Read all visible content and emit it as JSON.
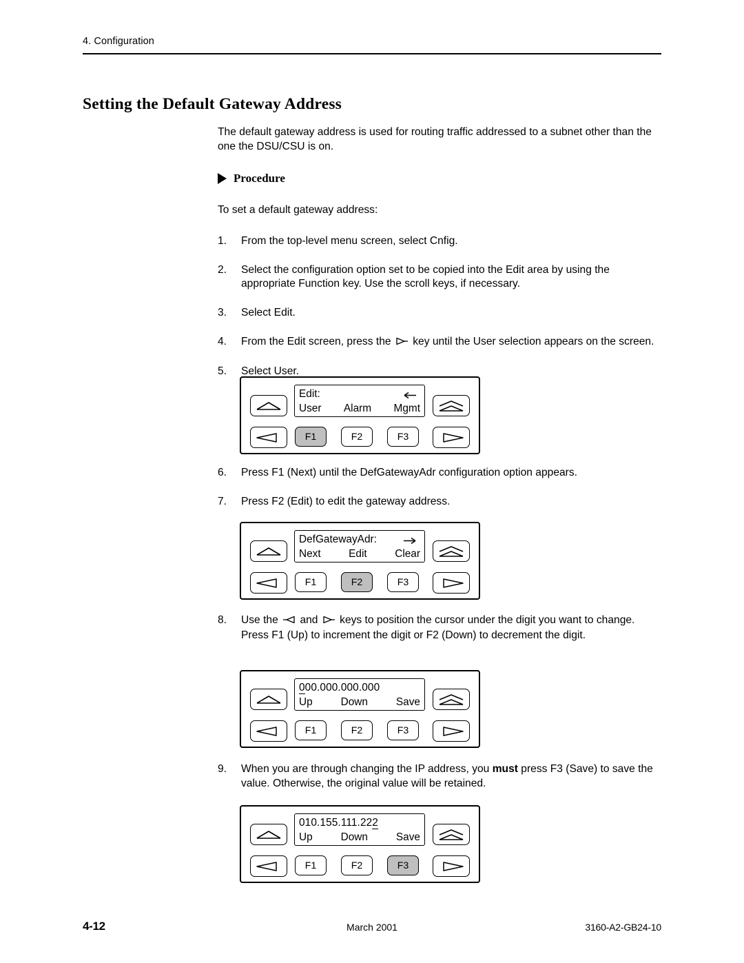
{
  "header": {
    "running_head": "4. Configuration"
  },
  "section": {
    "title": "Setting the Default Gateway Address"
  },
  "intro": {
    "paragraph": "The default gateway address is used for routing traffic addressed to a subnet other than the one the DSU/CSU is on."
  },
  "procedure": {
    "heading": "Procedure",
    "lead_in": "To set a default gateway address:",
    "steps": [
      {
        "num": "1.",
        "text": "From the top-level menu screen, select Cnfig."
      },
      {
        "num": "2.",
        "text": "Select the configuration option set to be copied into the Edit area by using the appropriate Function key. Use the scroll keys, if necessary."
      },
      {
        "num": "3.",
        "text": "Select Edit."
      },
      {
        "num": "4.",
        "text_before": "From the Edit screen, press the",
        "icon": "right-arrow-key-icon",
        "text_after": "key until the User selection appears on the screen."
      },
      {
        "num": "5.",
        "text": "Select User."
      },
      {
        "num": "6.",
        "text": "Press F1 (Next) until the DefGatewayAdr configuration option appears."
      },
      {
        "num": "7.",
        "text": "Press F2 (Edit) to edit the gateway address."
      },
      {
        "num": "8.",
        "text_before": "Use the",
        "icon": "left-arrow-key-icon",
        "text_mid": "and",
        "icon2": "right-arrow-key-icon",
        "text_after": "keys to position the cursor under the digit you want to change. Press F1 (Up) to increment the digit or F2 (Down) to decrement the digit."
      },
      {
        "num": "9.",
        "text_before": "When you are through changing the IP address, you",
        "bold": "must",
        "text_after": "press F3 (Save) to save the value. Otherwise, the original value will be retained."
      }
    ]
  },
  "panels": [
    {
      "name": "edit-user-panel",
      "lcd_line1": "Edit:",
      "lcd_arrow": "←",
      "lcd_arrow_name": "left-arrow-icon",
      "softkeys": [
        "User",
        "Alarm",
        "Mgmt"
      ],
      "function_keys": [
        "F1",
        "F2",
        "F3"
      ],
      "selected_function_key": "F1",
      "nav_keys": [
        "up-arrow-key",
        "left-arrow-key",
        "home-double-arrow-key",
        "right-arrow-key"
      ]
    },
    {
      "name": "defgatewayadr-panel",
      "lcd_line1": "DefGatewayAdr:",
      "lcd_arrow": "→",
      "lcd_arrow_name": "right-arrow-icon",
      "softkeys": [
        "Next",
        "Edit",
        "Clear"
      ],
      "function_keys": [
        "F1",
        "F2",
        "F3"
      ],
      "selected_function_key": "F2",
      "nav_keys": [
        "up-arrow-key",
        "left-arrow-key",
        "home-double-arrow-key",
        "right-arrow-key"
      ]
    },
    {
      "name": "gateway-zero-value-panel",
      "lcd_value": "000.000.000.000",
      "cursor_index": 0,
      "lcd_arrow": "",
      "lcd_arrow_name": "",
      "softkeys": [
        "Up",
        "Down",
        "Save"
      ],
      "function_keys": [
        "F1",
        "F2",
        "F3"
      ],
      "selected_function_key": "",
      "nav_keys": [
        "up-arrow-key",
        "left-arrow-key",
        "home-double-arrow-key",
        "right-arrow-key"
      ]
    },
    {
      "name": "gateway-edited-value-panel",
      "lcd_value": "010.155.111.222",
      "cursor_index": 14,
      "lcd_arrow": "",
      "lcd_arrow_name": "",
      "softkeys": [
        "Up",
        "Down",
        "Save"
      ],
      "function_keys": [
        "F1",
        "F2",
        "F3"
      ],
      "selected_function_key": "F3",
      "nav_keys": [
        "up-arrow-key",
        "left-arrow-key",
        "home-double-arrow-key",
        "right-arrow-key"
      ]
    }
  ],
  "footer": {
    "page_number": "4-12",
    "date": "March 2001",
    "doc_number": "3160-A2-GB24-10"
  },
  "colors": {
    "text": "#000000",
    "page_background": "#ffffff",
    "selected_key_fill": "#bfbfbf"
  }
}
